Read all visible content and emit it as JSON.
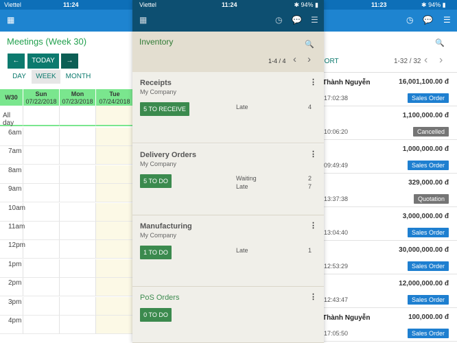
{
  "colors": {
    "accent_green": "#22a04e",
    "status_blue": "#1e84d0",
    "badge_sales": "#1e7fd0",
    "badge_cancelled": "#757575",
    "badge_quotation": "#757575",
    "header_dark": "#0d4f71"
  },
  "left": {
    "status": {
      "carrier": "Viettel",
      "time": "11:24"
    },
    "title": "Meetings (Week 30)",
    "buttons": {
      "prev": "←",
      "today": "TODAY",
      "next": "→"
    },
    "modes": [
      "DAY",
      "WEEK",
      "MONTH"
    ],
    "calendar": {
      "week_label": "W30",
      "days": [
        {
          "name": "Sun",
          "date": "07/22/2018"
        },
        {
          "name": "Mon",
          "date": "07/23/2018"
        },
        {
          "name": "Tue",
          "date": "07/24/2018"
        }
      ],
      "all_day": "All day",
      "hours": [
        "6am",
        "7am",
        "8am",
        "9am",
        "10am",
        "11am",
        "12pm",
        "1pm",
        "2pm",
        "3pm",
        "4pm"
      ]
    }
  },
  "middle": {
    "status": {
      "carrier": "Viettel",
      "time": "11:24",
      "battery": "94%"
    },
    "title": "Inventory",
    "pager": "1-4 / 4",
    "cards": [
      {
        "title": "Receipts",
        "company": "My Company",
        "action": "5 TO RECEIVE",
        "stats": [
          {
            "label": "Late",
            "value": "4"
          }
        ]
      },
      {
        "title": "Delivery Orders",
        "company": "My Company",
        "action": "5 TO DO",
        "stats": [
          {
            "label": "Waiting",
            "value": "2"
          },
          {
            "label": "Late",
            "value": "7"
          }
        ]
      },
      {
        "title": "Manufacturing",
        "company": "My Company",
        "action": "1 TO DO",
        "stats": [
          {
            "label": "Late",
            "value": "1"
          }
        ]
      },
      {
        "title": "PoS Orders",
        "company": "",
        "action": "0 TO DO",
        "stats": []
      }
    ]
  },
  "right": {
    "status": {
      "time": "11:23",
      "battery": "94%"
    },
    "export_label": "PORT",
    "pager": "1-32 / 32",
    "orders": [
      {
        "name": "Thành Nguyễn",
        "amount": "16,001,100.00 đ",
        "time": "17:02:38",
        "status": "Sales Order"
      },
      {
        "name": "",
        "amount": "1,100,000.00 đ",
        "time": "10:06:20",
        "status": "Cancelled"
      },
      {
        "name": "",
        "amount": "1,000,000.00 đ",
        "time": "09:49:49",
        "status": "Sales Order"
      },
      {
        "name": "",
        "amount": "329,000.00 đ",
        "time": "13:37:38",
        "status": "Quotation"
      },
      {
        "name": "",
        "amount": "3,000,000.00 đ",
        "time": "13:04:40",
        "status": "Sales Order"
      },
      {
        "name": "",
        "amount": "30,000,000.00 đ",
        "time": "12:53:29",
        "status": "Sales Order"
      },
      {
        "name": "",
        "amount": "12,000,000.00 đ",
        "time": "12:43:47",
        "status": "Sales Order"
      },
      {
        "name": "Thành Nguyễn",
        "amount": "100,000.00 đ",
        "time": "17:05:50",
        "status": "Sales Order"
      }
    ]
  }
}
